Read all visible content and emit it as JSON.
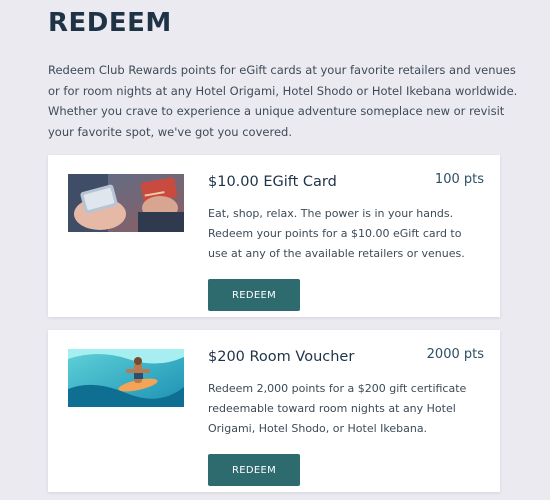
{
  "page": {
    "title": "REDEEM",
    "intro": "Redeem Club Rewards points for eGift cards at your favorite retailers and venues or for room nights at any Hotel Origami, Hotel Shodo or Hotel Ikebana worldwide. Whether you crave to experience a unique adventure someplace new or revisit your favorite spot, we've got you covered."
  },
  "rewards": [
    {
      "title": "$10.00 EGift Card",
      "points": "100 pts",
      "description": "Eat, shop, relax. The power is in your hands. Redeem your points for a $10.00 eGift card to use at any of the available retailers or venues.",
      "button_label": "REDEEM",
      "image": "phone-and-credit-card-photo"
    },
    {
      "title": "$200 Room Voucher",
      "points": "2000 pts",
      "description": "Redeem 2,000 points for a $200 gift certificate redeemable toward room nights at any Hotel Origami, Hotel Shodo, or Hotel Ikebana.",
      "button_label": "REDEEM",
      "image": "surfer-wave-photo"
    }
  ],
  "colors": {
    "background": "#eceaf1",
    "heading": "#1f3347",
    "button": "#2d6b6e",
    "card": "#ffffff"
  }
}
